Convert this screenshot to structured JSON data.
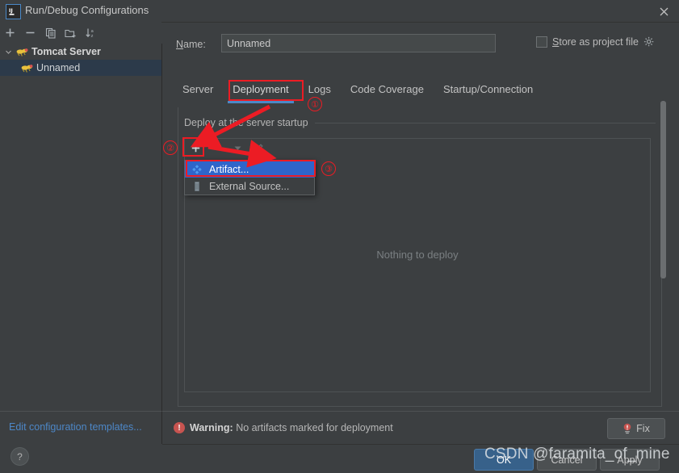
{
  "window": {
    "title": "Run/Debug Configurations",
    "logo_icon": "intellij-idea-logo",
    "close_icon": "close-icon"
  },
  "left_toolbar": {
    "buttons": [
      {
        "name": "add-configuration-button",
        "icon": "plus-icon",
        "label": "+"
      },
      {
        "name": "remove-configuration-button",
        "icon": "minus-icon",
        "label": "−"
      },
      {
        "name": "copy-configuration-button",
        "icon": "copy-icon",
        "label": ""
      },
      {
        "name": "save-configuration-button",
        "icon": "folder-add-icon",
        "label": ""
      },
      {
        "name": "sort-configurations-button",
        "icon": "sort-az-icon",
        "label": ""
      }
    ]
  },
  "tree": {
    "group": {
      "label": "Tomcat Server",
      "icon": "tomcat-icon",
      "expanded": true,
      "chevron_icon": "chevron-down-icon"
    },
    "children": [
      {
        "label": "Unnamed",
        "icon": "tomcat-icon",
        "selected": true
      }
    ]
  },
  "left_bottom": {
    "edit_templates_link": "Edit configuration templates...",
    "help_button_label": "?",
    "help_icon": "question-mark-icon"
  },
  "name_row": {
    "label_prefix": "N",
    "label_rest": "ame:",
    "value": "Unnamed",
    "placeholder": "Unnamed",
    "store_as_project_file": {
      "checked": false,
      "label_prefix": "S",
      "label_rest": "tore as project file",
      "gear_icon": "gear-icon"
    }
  },
  "tabs": [
    {
      "label": "Server",
      "active": false
    },
    {
      "label": "Deployment",
      "active": true
    },
    {
      "label": "Logs",
      "active": false
    },
    {
      "label": "Code Coverage",
      "active": false
    },
    {
      "label": "Startup/Connection",
      "active": false
    }
  ],
  "deployment": {
    "section_title": "Deploy at the server startup",
    "toolbar_buttons": [
      {
        "name": "add-deployment-button",
        "icon": "plus-icon",
        "enabled": true
      },
      {
        "name": "move-up-button",
        "icon": "arrow-up-icon",
        "enabled": false
      },
      {
        "name": "move-down-button",
        "icon": "arrow-down-icon",
        "enabled": false
      },
      {
        "name": "edit-deployment-button",
        "icon": "pencil-icon",
        "enabled": false
      }
    ],
    "empty_text": "Nothing to deploy",
    "popup_menu": [
      {
        "label": "Artifact...",
        "icon": "artifact-icon",
        "selected": true
      },
      {
        "label": "External Source...",
        "icon": "external-source-icon",
        "selected": false
      }
    ]
  },
  "warning_bar": {
    "icon": "error-icon",
    "prefix": "Warning:",
    "message": "No artifacts marked for deployment",
    "fix_button_label": "Fix",
    "fix_button_icon": "error-icon"
  },
  "dialog_buttons": {
    "ok": "OK",
    "cancel": "Cancel",
    "apply": "Apply"
  },
  "watermark": "CSDN @faramita_of_mine",
  "annotations": {
    "step1": "①",
    "step2": "②",
    "step3": "③",
    "color": "#ec1c24"
  },
  "colors": {
    "background": "#3c3f41",
    "accent_blue": "#4a88c7",
    "selection_blue": "#2f65ca",
    "tree_selection": "#2c3a4a",
    "link_blue": "#4d87c7",
    "warning_red": "#c75450",
    "annotation_red": "#ec1c24"
  }
}
